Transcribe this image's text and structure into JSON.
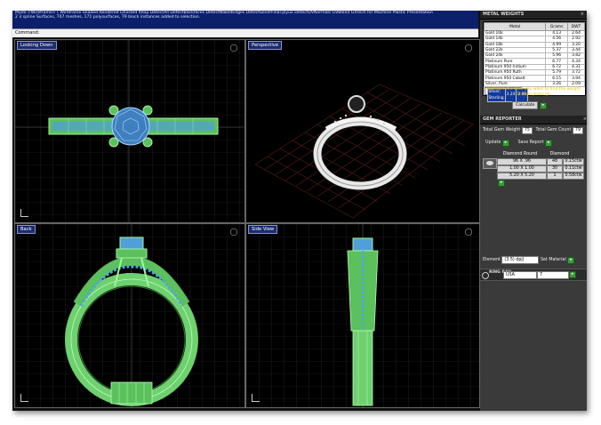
{
  "command": {
    "lines": [
      "Mode <Wireframe> ( Wireframe  Shaded  Rendered  Ghosted  XRay  DetectAll  DetectBackfaces  DetectNakedEdges  DetectSeverFinal.plyux  DetectUVNormals  GVBlend  GXTech for Machine  Plastic  Presentation",
      "2 3 spline Surfaces, 747 meshes, 171 polysurfaces, 79 block instances added to selection."
    ],
    "prompt": "Command:"
  },
  "viewports": {
    "top_left": {
      "title": "Looking Down"
    },
    "top_right": {
      "title": "Perspective"
    },
    "bottom_left": {
      "title": "Back"
    },
    "bottom_right": {
      "title": "Side View"
    }
  },
  "metal_weights": {
    "header": "METAL WEIGHTS",
    "columns": [
      "Metal",
      "Grams",
      "DWT"
    ],
    "rows": [
      [
        "Gold 10k",
        "4.13",
        "2.64"
      ],
      [
        "Gold 14k",
        "4.56",
        "2.92"
      ],
      [
        "Gold 18k",
        "4.99",
        "3.20"
      ],
      [
        "Gold 22k",
        "5.37",
        "3.44"
      ],
      [
        "Gold 24k",
        "5.96",
        "3.82"
      ],
      [
        "Platinum Pure",
        "6.77",
        "4.34"
      ],
      [
        "Platinum 950 Iridium",
        "6.72",
        "4.31"
      ],
      [
        "Platinum 950 Ruth",
        "5.79",
        "3.72"
      ],
      [
        "Platinum 950 Cobalt",
        "6.15",
        "3.94"
      ],
      [
        "Silver, Pure",
        "3.26",
        "2.09"
      ],
      [
        "Silver, Sterling",
        "3.24",
        "2.08"
      ]
    ],
    "selected_row": 10,
    "hint": "Highlight the item you want to find the weight for then press go.",
    "calculate_label": "Calculate",
    "go_label": "▸"
  },
  "gem_reporter": {
    "header": "GEM REPORTER",
    "total_weight_label": "Total Gem Weight",
    "total_weight_value": "75",
    "total_count_label": "Total Gem Count",
    "total_count_value": "79",
    "update_label": "Update",
    "save_report_label": "Save Report",
    "col_shape": "Diamond Round",
    "col_type": "Diamond",
    "rows": [
      [
        "96 X .96",
        "48",
        "0.15ctw"
      ],
      [
        "1.00 X 1.00",
        "30",
        "0.11ctw"
      ],
      [
        "5.20 X 5.20",
        "1",
        "0.58ctw"
      ]
    ]
  },
  "element": {
    "label": "Element",
    "value": "(3.5) dpj)",
    "set_material_label": "Set Material"
  },
  "ring_rail": {
    "label": "RING RAIL",
    "system": "USA",
    "size": "7"
  },
  "colors": {
    "wire_green": "#7fe07f",
    "gem_blue": "#4fa8e0",
    "grid": "#2a2a2a",
    "command_bg": "#0b1f6b"
  }
}
